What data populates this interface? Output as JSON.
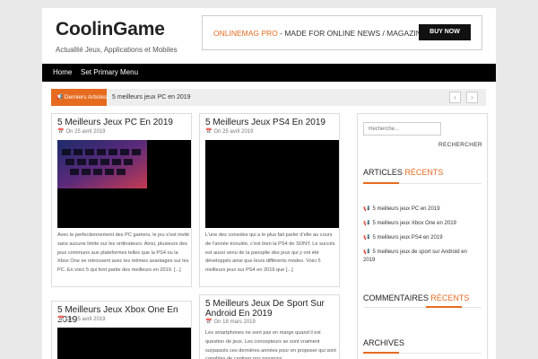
{
  "site": {
    "title": "CoolinGame",
    "description": "Actualité Jeux, Applications et Mobiles"
  },
  "banner": {
    "highlight": "ONLINEMAG PRO",
    "text": " - MADE FOR ONLINE NEWS / MAGAZINE",
    "button": "BUY NOW"
  },
  "nav": {
    "items": [
      "Home",
      "Set Primary Menu"
    ]
  },
  "ticker": {
    "label": "Derniers Articles",
    "text": "5 meilleurs jeux PC en 2019",
    "prev": "‹",
    "next": "›"
  },
  "posts": [
    {
      "title": "5 Meilleurs Jeux PC En 2019",
      "date": "On 25 avril 2019",
      "excerpt": "Avec le perfectionnement des PC gamers, le jeu s’est invité sans aucune limite sur les ordinateurs. Ainsi, plusieurs des jeux communs aux plateformes telles que la PS4 ou la Xbox One se retrouvent avec les mêmes avantages sur les PC. En voici 5 qui font partie des meilleurs en 2019. [...]"
    },
    {
      "title": "5 Meilleurs Jeux PS4 En 2019",
      "date": "On 25 avril 2019",
      "excerpt": "L’une des consoles qui a le plus fait parler d’elle au cours de l’année écoulée, c’est bien la PS4 de SONY. Le succès est aussi venu de la panoplie des jeux qui y ont été développés ainsi que leurs différents modes. Voici 5 meilleurs jeux sur PS4 en 2019 que [...]"
    },
    {
      "title": "5 Meilleurs Jeux Xbox One En 2019",
      "date": "On 25 avril 2019",
      "excerpt": ""
    },
    {
      "title": "5 Meilleurs Jeux De Sport Sur Android En 2019",
      "date": "On 18 mars 2019",
      "excerpt": "Les smartphones ne sont pas en marge quand il est question de jeux. Les concepteurs se sont vraiment surpassés ces dernières années pour en proposer qui sont capables de captiver nos passions"
    }
  ],
  "sidebar": {
    "search_placeholder": "Recherche...",
    "search_button": "RECHERCHER",
    "articles_title_a": "ARTICLES",
    "articles_title_b": "RÉCENTS",
    "articles": [
      "5 meilleurs jeux PC en 2019",
      "5 meilleurs jeux Xbox One en 2019",
      "5 meilleurs jeux PS4 en 2019",
      "5 meilleurs jeux de sport sur Android en 2019"
    ],
    "comments_title_a": "COMMENTAIRES",
    "comments_title_b": "RÉCENTS",
    "archives_title": "ARCHIVES"
  },
  "colors": {
    "accent": "#e66b1f",
    "nav_bg": "#000000",
    "page_bg": "#e9e9e9"
  },
  "icons": {
    "ticker": "megaphone-icon",
    "date": "calendar-icon",
    "bullet": "megaphone-icon"
  }
}
